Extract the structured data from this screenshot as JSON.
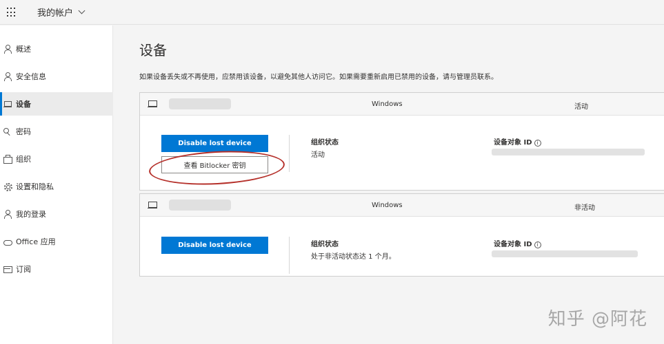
{
  "header": {
    "account_label": "我的帐户"
  },
  "sidebar": {
    "items": [
      {
        "label": "概述",
        "icon": "person-icon"
      },
      {
        "label": "安全信息",
        "icon": "security-info-icon"
      },
      {
        "label": "设备",
        "icon": "laptop-icon",
        "active": true
      },
      {
        "label": "密码",
        "icon": "key-icon"
      },
      {
        "label": "组织",
        "icon": "briefcase-icon"
      },
      {
        "label": "设置和隐私",
        "icon": "gear-icon"
      },
      {
        "label": "我的登录",
        "icon": "sign-in-icon"
      },
      {
        "label": "Office 应用",
        "icon": "cloud-icon"
      },
      {
        "label": "订阅",
        "icon": "card-icon"
      }
    ]
  },
  "main": {
    "title": "设备",
    "description": "如果设备丢失或不再使用，应禁用该设备，以避免其他人访问它。如果需要重新启用已禁用的设备，请与管理员联系。"
  },
  "devices": [
    {
      "os": "Windows",
      "status": "活动",
      "disable_label": "Disable lost device",
      "bitlocker_label": "查看 Bitlocker 密钥",
      "org_state_label": "组织状态",
      "org_state_value": "活动",
      "object_id_label": "设备对象 ID"
    },
    {
      "os": "Windows",
      "status": "非活动",
      "disable_label": "Disable lost device",
      "org_state_label": "组织状态",
      "org_state_value": "处于非活动状态达 1 个月。",
      "object_id_label": "设备对象 ID"
    }
  ],
  "watermark": "知乎 @阿花",
  "colors": {
    "accent": "#0078d4",
    "highlight_ellipse": "#b5302a"
  }
}
